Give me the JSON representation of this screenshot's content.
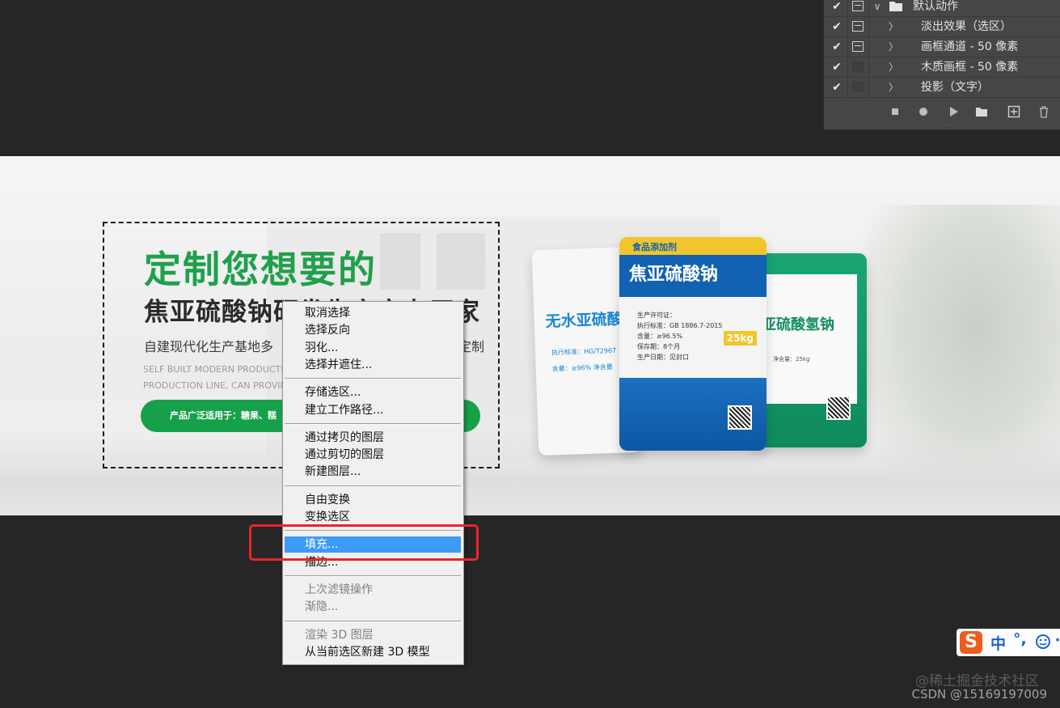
{
  "actions_panel": {
    "rows": [
      {
        "checked": true,
        "dialog": true,
        "expanded": true,
        "is_folder": true,
        "label": "默认动作"
      },
      {
        "checked": true,
        "dialog": true,
        "expanded": false,
        "is_folder": false,
        "label": "淡出效果（选区）"
      },
      {
        "checked": true,
        "dialog": true,
        "expanded": false,
        "is_folder": false,
        "label": "画框通道 - 50 像素"
      },
      {
        "checked": true,
        "dialog": false,
        "expanded": false,
        "is_folder": false,
        "label": "木质画框 - 50 像素"
      },
      {
        "checked": true,
        "dialog": false,
        "expanded": false,
        "is_folder": false,
        "label": "投影（文字）"
      }
    ],
    "check_glyph": "✔",
    "collapsed_glyph": "〉",
    "expanded_glyph": "∨",
    "toolbar_icons": [
      "stop-icon",
      "record-icon",
      "play-icon",
      "new-set-folder-icon",
      "new-action-icon",
      "delete-icon"
    ],
    "grip": "·····"
  },
  "canvas": {
    "headline": "定制您想要的",
    "subheadline": "焦亚硫酸钠研发生产实力厂家",
    "desc_cn": "自建现代化生产基地多",
    "desc_cn_tail": "定制",
    "desc_en_line1": "SELF BUILT MODERN PRODUCTIO",
    "desc_en_line2": "PRODUCTION LINE, CAN PROVIDE",
    "pill_text": "产品广泛适用于：糖果、糕",
    "bags": {
      "white_label": "无水亚硫酸",
      "white_small_1": "执行标准：HG/T2967",
      "white_small_2": "含量：≥96% 净含量",
      "blue_tag": "食品添加剂",
      "blue_label": "焦亚硫酸钠",
      "blue_line1": "生产许可证：",
      "blue_line2": "执行标准：GB 1886.7-2015",
      "blue_line3": "含量：≥96.5%",
      "blue_line4": "保存期：8个月",
      "blue_line5": "生产日期：见封口",
      "blue_kg": "25kg",
      "green_label": "亚硫酸氢钠",
      "green_small": "净含量：25kg"
    }
  },
  "context_menu": {
    "groups": [
      [
        {
          "label": "取消选择"
        },
        {
          "label": "选择反向"
        },
        {
          "label": "羽化..."
        },
        {
          "label": "选择并遮住..."
        }
      ],
      [
        {
          "label": "存储选区..."
        },
        {
          "label": "建立工作路径..."
        }
      ],
      [
        {
          "label": "通过拷贝的图层"
        },
        {
          "label": "通过剪切的图层"
        },
        {
          "label": "新建图层..."
        }
      ],
      [
        {
          "label": "自由变换"
        },
        {
          "label": "变换选区"
        }
      ],
      [
        {
          "label": "填充...",
          "highlighted": true
        },
        {
          "label": "描边..."
        }
      ],
      [
        {
          "label": "上次滤镜操作",
          "disabled": true
        },
        {
          "label": "渐隐...",
          "disabled": true
        }
      ],
      [
        {
          "label": "渲染 3D 图层",
          "disabled": true
        },
        {
          "label": "从当前选区新建 3D 模型"
        }
      ]
    ]
  },
  "ime": {
    "logo": "S",
    "lang": "中",
    "punct": "°,",
    "more": "⋯"
  },
  "watermarks": {
    "juejin": "@稀土掘金技术社区",
    "csdn": "CSDN @15169197009"
  },
  "colors": {
    "highlight": "#3b9bf5",
    "callout": "#e8262a",
    "headline_green": "#1fa04b",
    "ps_background": "#262626",
    "panel_bg": "#464646"
  }
}
